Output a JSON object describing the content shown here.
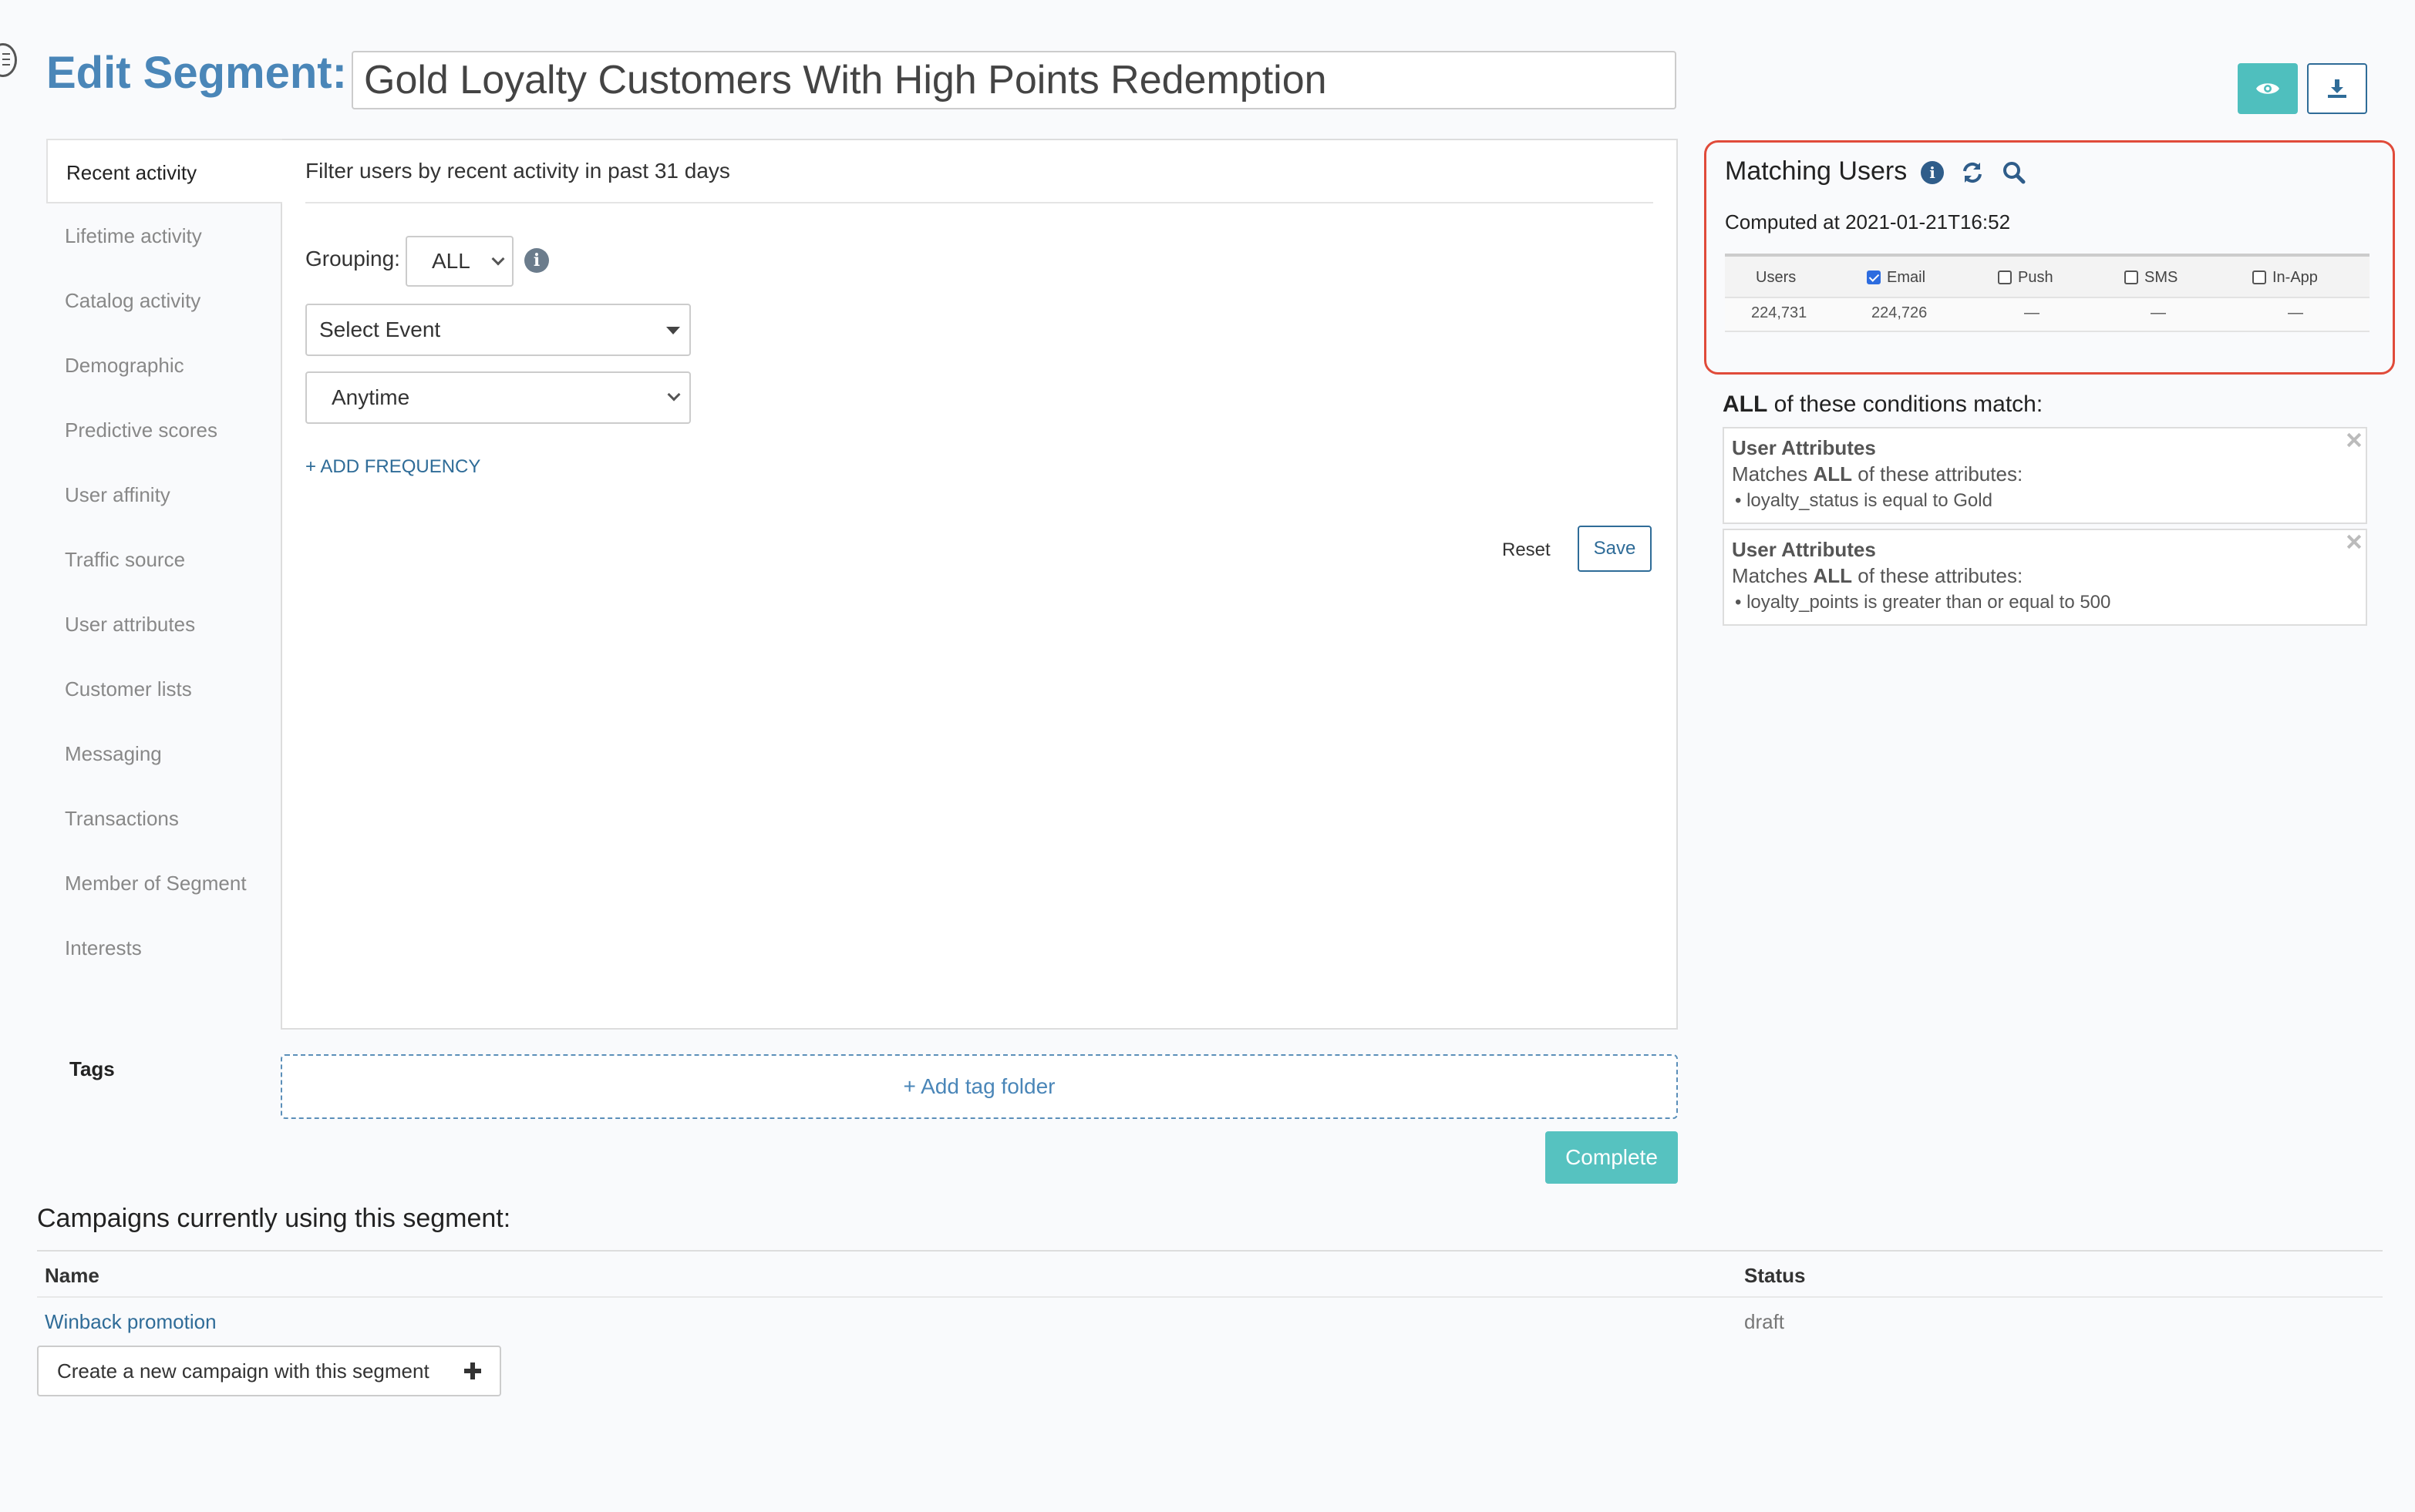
{
  "header": {
    "title_prefix": "Edit Segment:",
    "segment_name": "Gold Loyalty Customers With High Points Redemption"
  },
  "sidebar": {
    "items": [
      {
        "label": "Recent activity",
        "active": true
      },
      {
        "label": "Lifetime activity"
      },
      {
        "label": "Catalog activity"
      },
      {
        "label": "Demographic"
      },
      {
        "label": "Predictive scores"
      },
      {
        "label": "User affinity"
      },
      {
        "label": "Traffic source"
      },
      {
        "label": "User attributes"
      },
      {
        "label": "Customer lists"
      },
      {
        "label": "Messaging"
      },
      {
        "label": "Transactions"
      },
      {
        "label": "Member of Segment"
      },
      {
        "label": "Interests"
      }
    ]
  },
  "filter": {
    "heading": "Filter users by recent activity in past 31 days",
    "grouping_label": "Grouping:",
    "grouping_value": "ALL",
    "event_select": "Select Event",
    "time_select": "Anytime",
    "add_frequency": "+ ADD FREQUENCY",
    "reset_label": "Reset",
    "save_label": "Save"
  },
  "tags": {
    "label": "Tags",
    "add_folder": "+ Add tag folder"
  },
  "complete_label": "Complete",
  "campaigns": {
    "heading": "Campaigns currently using this segment:",
    "columns": [
      "Name",
      "Status"
    ],
    "rows": [
      {
        "name": "Winback promotion",
        "status": "draft"
      }
    ],
    "new_campaign_label": "Create a new campaign with this segment"
  },
  "matching": {
    "title": "Matching Users",
    "computed": "Computed at 2021-01-21T16:52",
    "columns": [
      {
        "label": "Users"
      },
      {
        "label": "Email",
        "checked": true
      },
      {
        "label": "Push",
        "checked": false
      },
      {
        "label": "SMS",
        "checked": false
      },
      {
        "label": "In-App",
        "checked": false
      }
    ],
    "values": [
      "224,731",
      "224,726",
      "—",
      "—",
      "—"
    ]
  },
  "conditions": {
    "heading_bold": "ALL",
    "heading_rest": " of these conditions match:",
    "cards": [
      {
        "title": "User Attributes",
        "prefix": "Matches ",
        "bold": "ALL",
        "suffix": " of these attributes:",
        "item": "• loyalty_status is equal to Gold"
      },
      {
        "title": "User Attributes",
        "prefix": "Matches ",
        "bold": "ALL",
        "suffix": " of these attributes:",
        "item": "• loyalty_points is greater than or equal to 500"
      }
    ]
  },
  "colors": {
    "accent_teal": "#4fbfbe",
    "link_blue": "#2f6c98",
    "title_blue": "#4a86b8",
    "highlight_red": "#e04b3a"
  }
}
